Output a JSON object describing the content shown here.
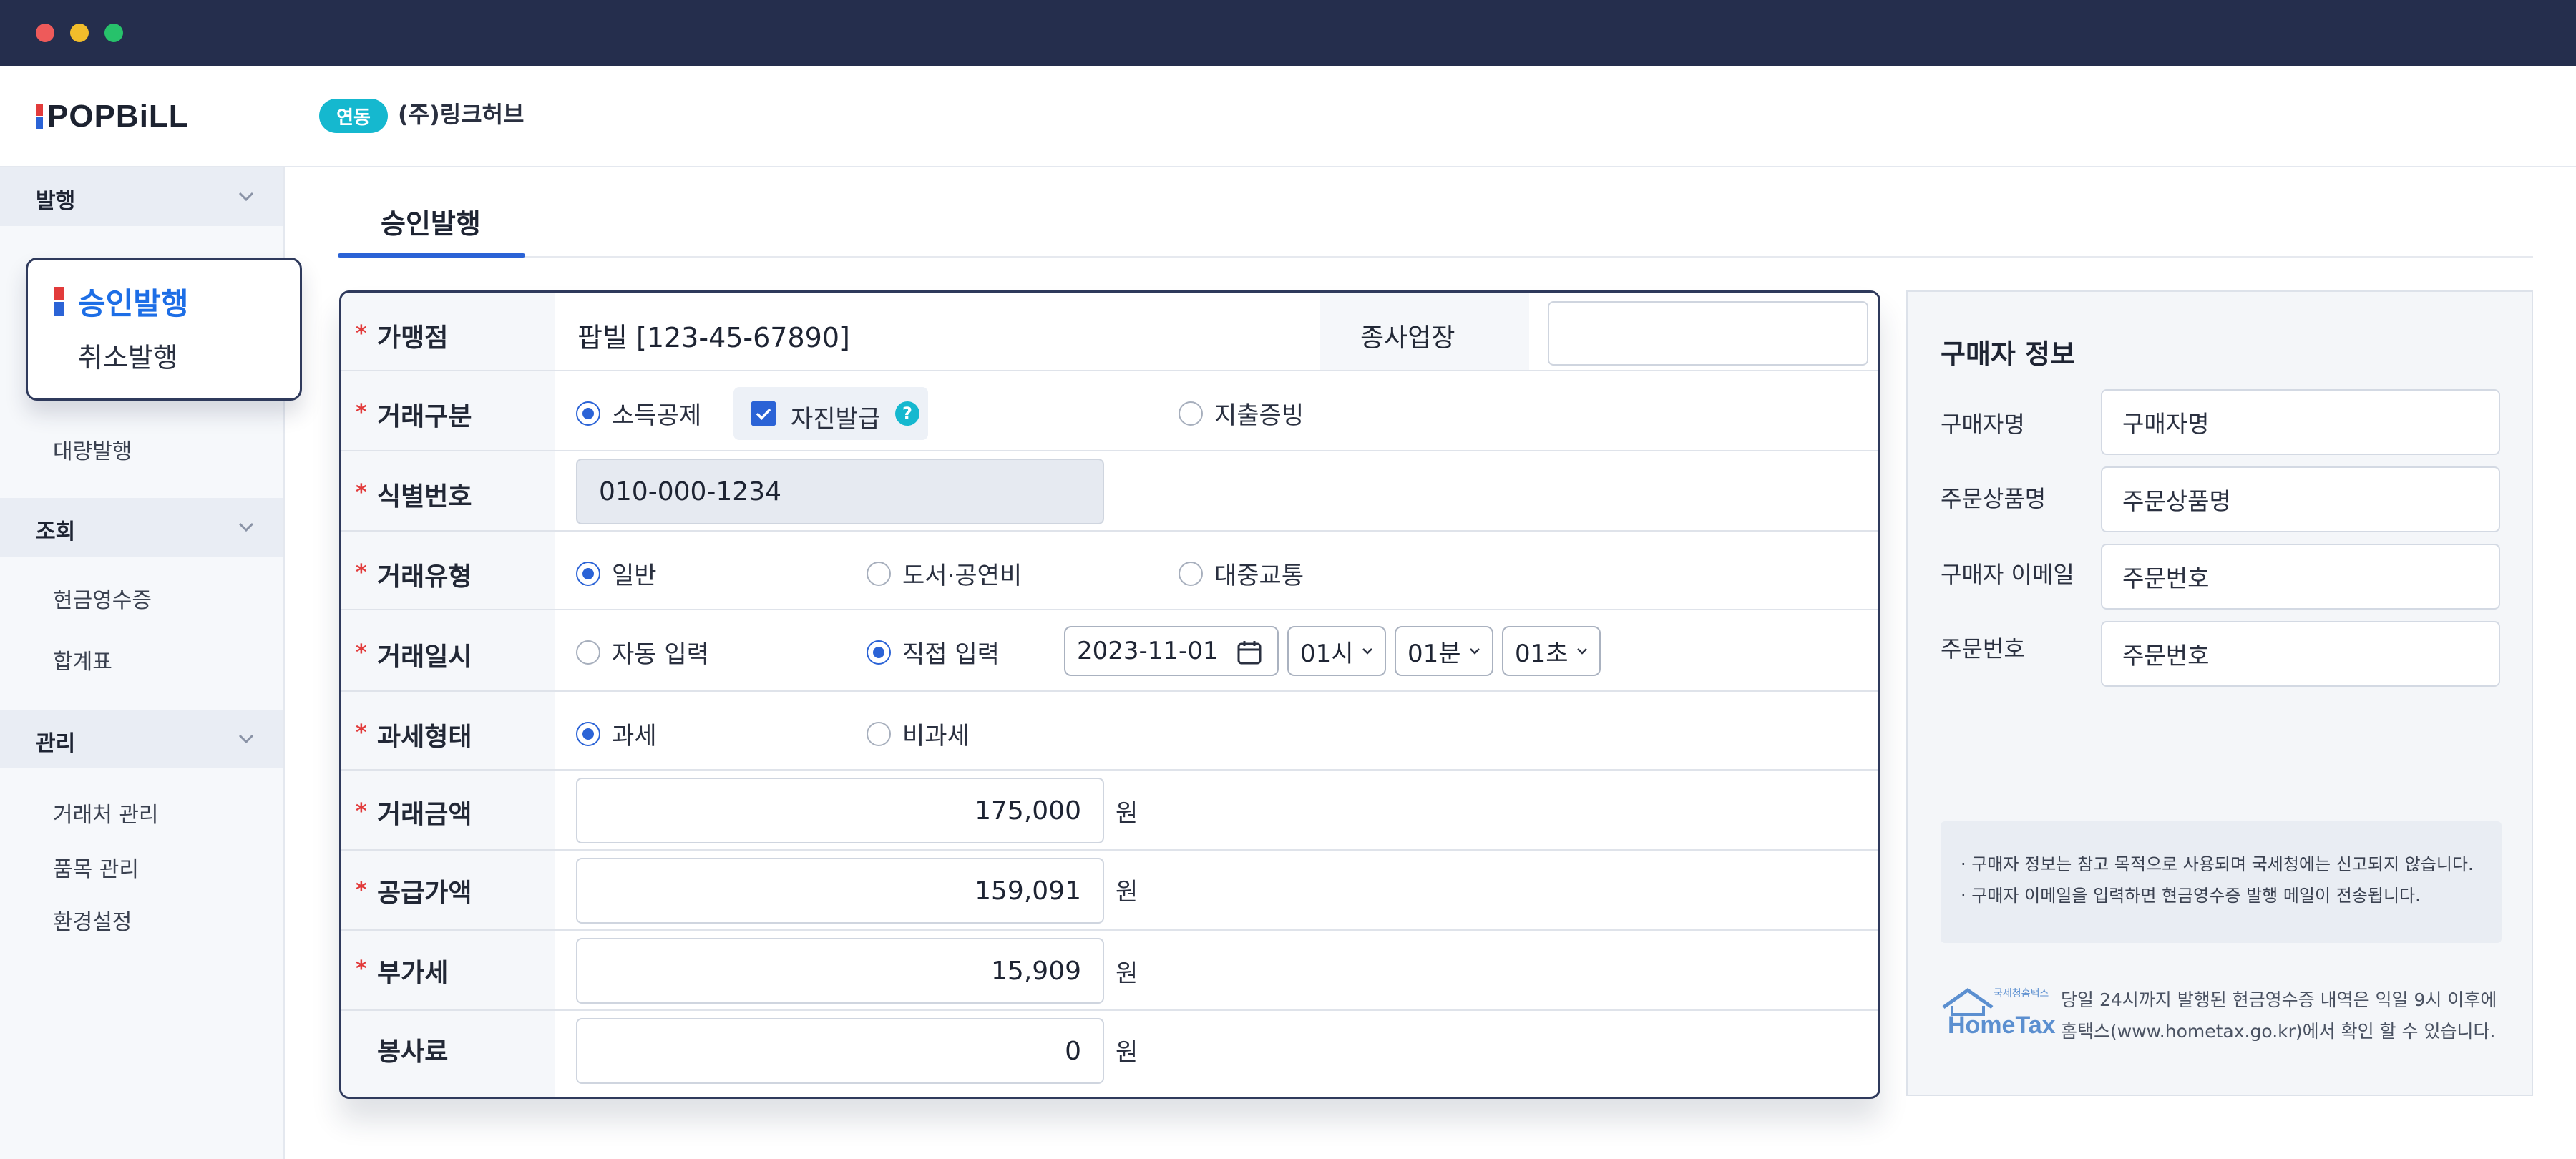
{
  "brand": {
    "logo_text": "POPBiLL",
    "badge": "연동",
    "company": "(주)링크허브"
  },
  "colors": {
    "accent": "#2b63d6",
    "badge": "#15b8cf",
    "required": "#e23b3b",
    "titlebar": "#252e4d"
  },
  "sidebar": {
    "groups": [
      {
        "label": "발행",
        "items": [
          "승인발행",
          "취소발행",
          "대량발행"
        ]
      },
      {
        "label": "조회",
        "items": [
          "현금영수증",
          "합계표"
        ]
      },
      {
        "label": "관리",
        "items": [
          "거래처 관리",
          "품목 관리",
          "환경설정"
        ]
      }
    ],
    "active_item": "승인발행"
  },
  "tab": {
    "label": "승인발행"
  },
  "form": {
    "merchant": {
      "label": "가맹점",
      "value": "팝빌 [123-45-67890]",
      "sub_label": "종사업장",
      "sub_value": ""
    },
    "trade_type": {
      "label": "거래구분",
      "options": [
        "소득공제",
        "지출증빙"
      ],
      "selected": "소득공제",
      "self_issue_label": "자진발급",
      "self_issue_checked": true,
      "help": "?"
    },
    "id_number": {
      "label": "식별번호",
      "value": "010-000-1234"
    },
    "trade_kind": {
      "label": "거래유형",
      "options": [
        "일반",
        "도서·공연비",
        "대중교통"
      ],
      "selected": "일반"
    },
    "trade_date": {
      "label": "거래일시",
      "options": [
        "자동 입력",
        "직접 입력"
      ],
      "selected": "직접 입력",
      "date": "2023-11-01",
      "hour": "01시",
      "minute": "01분",
      "second": "01초"
    },
    "tax_type": {
      "label": "과세형태",
      "options": [
        "과세",
        "비과세"
      ],
      "selected": "과세"
    },
    "amount": {
      "label": "거래금액",
      "value": "175,000",
      "unit": "원"
    },
    "supply": {
      "label": "공급가액",
      "value": "159,091",
      "unit": "원"
    },
    "vat": {
      "label": "부가세",
      "value": "15,909",
      "unit": "원"
    },
    "service": {
      "label": "봉사료",
      "value": "0",
      "unit": "원"
    }
  },
  "buyer": {
    "title": "구매자 정보",
    "fields": [
      {
        "label": "구매자명",
        "value": "구매자명"
      },
      {
        "label": "주문상품명",
        "value": "주문상품명"
      },
      {
        "label": "구매자 이메일",
        "value": "주문번호"
      },
      {
        "label": "주문번호",
        "value": "주문번호"
      }
    ],
    "notes": [
      "· 구매자 정보는 참고 목적으로 사용되며 국세청에는 신고되지 않습니다.",
      "· 구매자 이메일을 입력하면 현금영수증 발행 메일이 전송됩니다."
    ],
    "hometax_logo": "HomeTax",
    "hometax_logo_small": "국세청홈택스",
    "hometax_lines": [
      "당일 24시까지 발행된 현금영수증 내역은 익일 9시 이후에",
      "홈택스(www.hometax.go.kr)에서 확인 할 수 있습니다."
    ]
  }
}
